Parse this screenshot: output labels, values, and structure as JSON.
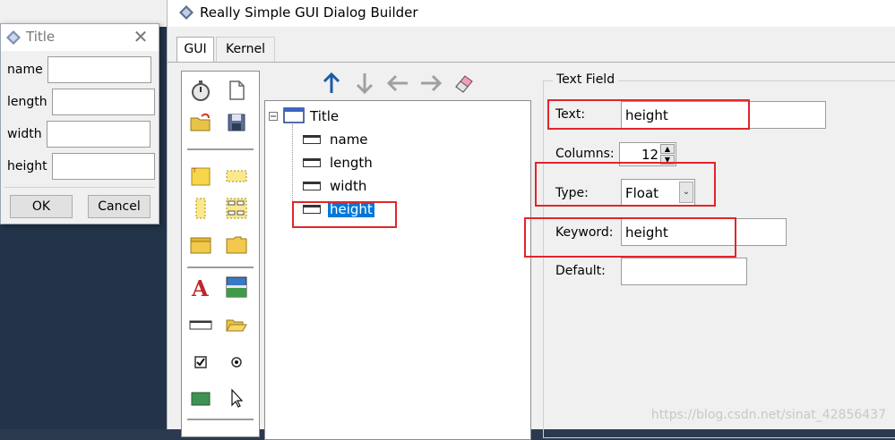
{
  "mini_dialog": {
    "title": "Title",
    "fields": [
      {
        "label": "name",
        "value": ""
      },
      {
        "label": "length",
        "value": ""
      },
      {
        "label": "width",
        "value": ""
      },
      {
        "label": "height",
        "value": ""
      }
    ],
    "ok_label": "OK",
    "cancel_label": "Cancel"
  },
  "main_window": {
    "title": "Really Simple GUI Dialog Builder",
    "tabs": [
      {
        "label": "GUI",
        "active": true
      },
      {
        "label": "Kernel",
        "active": false
      }
    ]
  },
  "toolbar": {
    "icons": [
      "arrow-up-icon",
      "arrow-down-icon",
      "arrow-left-icon",
      "arrow-right-icon",
      "eraser-icon"
    ]
  },
  "palette": {
    "icons": [
      "stopwatch-icon",
      "new-document-icon",
      "open-folder-icon",
      "save-disk-icon",
      "frame-icon",
      "horizontal-frame-icon",
      "vertical-frame-icon",
      "grid-frame-icon",
      "tab-folder-icon",
      "folder-icon",
      "label-text-icon",
      "image-icon",
      "text-field-icon",
      "file-open-icon",
      "checkbox-icon",
      "radio-icon",
      "color-swatch-icon",
      "pointer-icon"
    ]
  },
  "tree": {
    "root": "Title",
    "children": [
      "name",
      "length",
      "width",
      "height"
    ],
    "selected": "height"
  },
  "properties": {
    "group_title": "Text Field",
    "text_label": "Text:",
    "text_value": "height",
    "columns_label": "Columns:",
    "columns_value": "12",
    "type_label": "Type:",
    "type_value": "Float",
    "keyword_label": "Keyword:",
    "keyword_value": "height",
    "default_label": "Default:",
    "default_value": ""
  },
  "watermark": "https://blog.csdn.net/sinat_42856437",
  "colors": {
    "highlight_box": "#e2252b",
    "selection": "#0078d7"
  }
}
